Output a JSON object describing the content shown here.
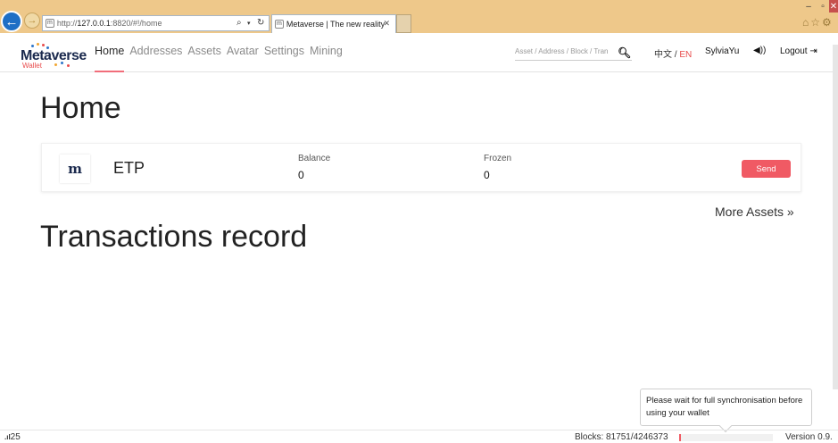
{
  "browser": {
    "url_prefix": "http://",
    "url_host": "127.0.0.1",
    "url_rest": ":8820/#!/home",
    "tab_title": "Metaverse | The new reality",
    "favicon_label": "m"
  },
  "nav": {
    "logo_text": "Metaverse",
    "logo_sub": "Wallet",
    "links": [
      "Home",
      "Addresses",
      "Assets",
      "Avatar",
      "Settings",
      "Mining"
    ],
    "search_placeholder": "Asset / Address / Block / Tran",
    "lang_zh": "中文",
    "lang_sep": " / ",
    "lang_en": "EN",
    "user": "SylviaYu",
    "logout": "Logout"
  },
  "main": {
    "title": "Home",
    "asset": {
      "icon_label": "m",
      "name": "ETP",
      "balance_label": "Balance",
      "balance": "0",
      "frozen_label": "Frozen",
      "frozen": "0",
      "send_label": "Send"
    },
    "more_assets": "More Assets »",
    "tx_title": "Transactions record"
  },
  "tooltip": "Please wait for full synchronisation before using your wallet",
  "footer": {
    "peers": "25",
    "blocks": "Blocks: 81751/4246373",
    "sync_progress": 0.02,
    "version": "Version 0.9."
  },
  "colors": {
    "accent": "#f05a64",
    "browser_frame": "#eec88a",
    "brand_navy": "#1b2a4e"
  },
  "icons": [
    "back-icon",
    "forward-icon",
    "search-icon",
    "refresh-icon",
    "home-icon",
    "star-icon",
    "gear-icon",
    "sound-icon",
    "logout-icon",
    "signal-icon"
  ]
}
